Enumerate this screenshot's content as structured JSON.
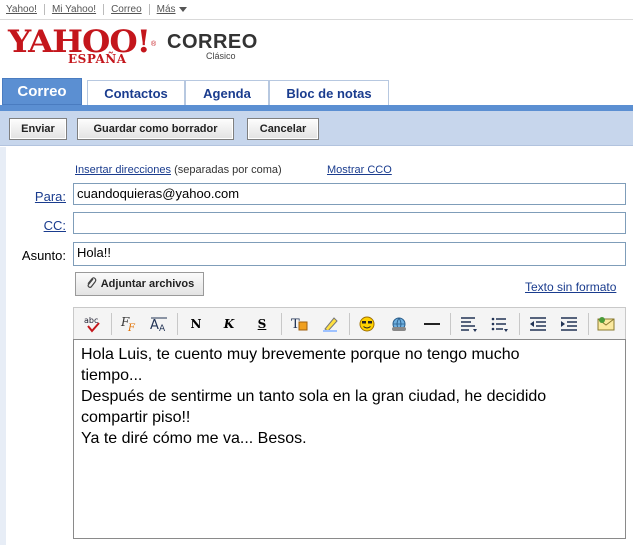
{
  "top_links": {
    "yahoo": "Yahoo!",
    "mi_yahoo": "Mi Yahoo!",
    "correo": "Correo",
    "mas": "Más"
  },
  "logo": {
    "text": "YAHOO!",
    "region": "ESPAÑA"
  },
  "app": {
    "title": "CORREO",
    "subtitle": "Clásico"
  },
  "tabs": [
    {
      "label": "Correo",
      "active": true
    },
    {
      "label": "Contactos",
      "active": false
    },
    {
      "label": "Agenda",
      "active": false
    },
    {
      "label": "Bloc de notas",
      "active": false
    }
  ],
  "toolbar": {
    "send": "Enviar",
    "save_draft": "Guardar como borrador",
    "cancel": "Cancelar"
  },
  "compose": {
    "insert_addresses": "Insertar direcciones",
    "insert_hint": "(separadas por coma)",
    "show_bcc": "Mostrar CCO",
    "to_label": "Para:",
    "to_value": "cuandoquieras@yahoo.com",
    "cc_label": "CC:",
    "cc_value": "",
    "subject_label": "Asunto:",
    "subject_value": "Hola!!",
    "attach": "Adjuntar archivos",
    "plain_text": "Texto sin formato",
    "body_lines": [
      "Hola Luis, te cuento muy brevemente porque no tengo mucho",
      "tiempo...",
      "Después de sentirme un tanto sola en la gran ciudad, he decidido",
      "compartir piso!!",
      "Ya te diré cómo me va... Besos."
    ]
  },
  "editor_toolbar": {
    "bold": "N",
    "italic": "K",
    "underline": "S",
    "spell_check": "abc"
  },
  "colors": {
    "brand_red": "#c4161c",
    "tab_blue": "#5b8fd2",
    "toolbar_bg": "#c7d6ec",
    "link_blue": "#1a3c8e"
  }
}
